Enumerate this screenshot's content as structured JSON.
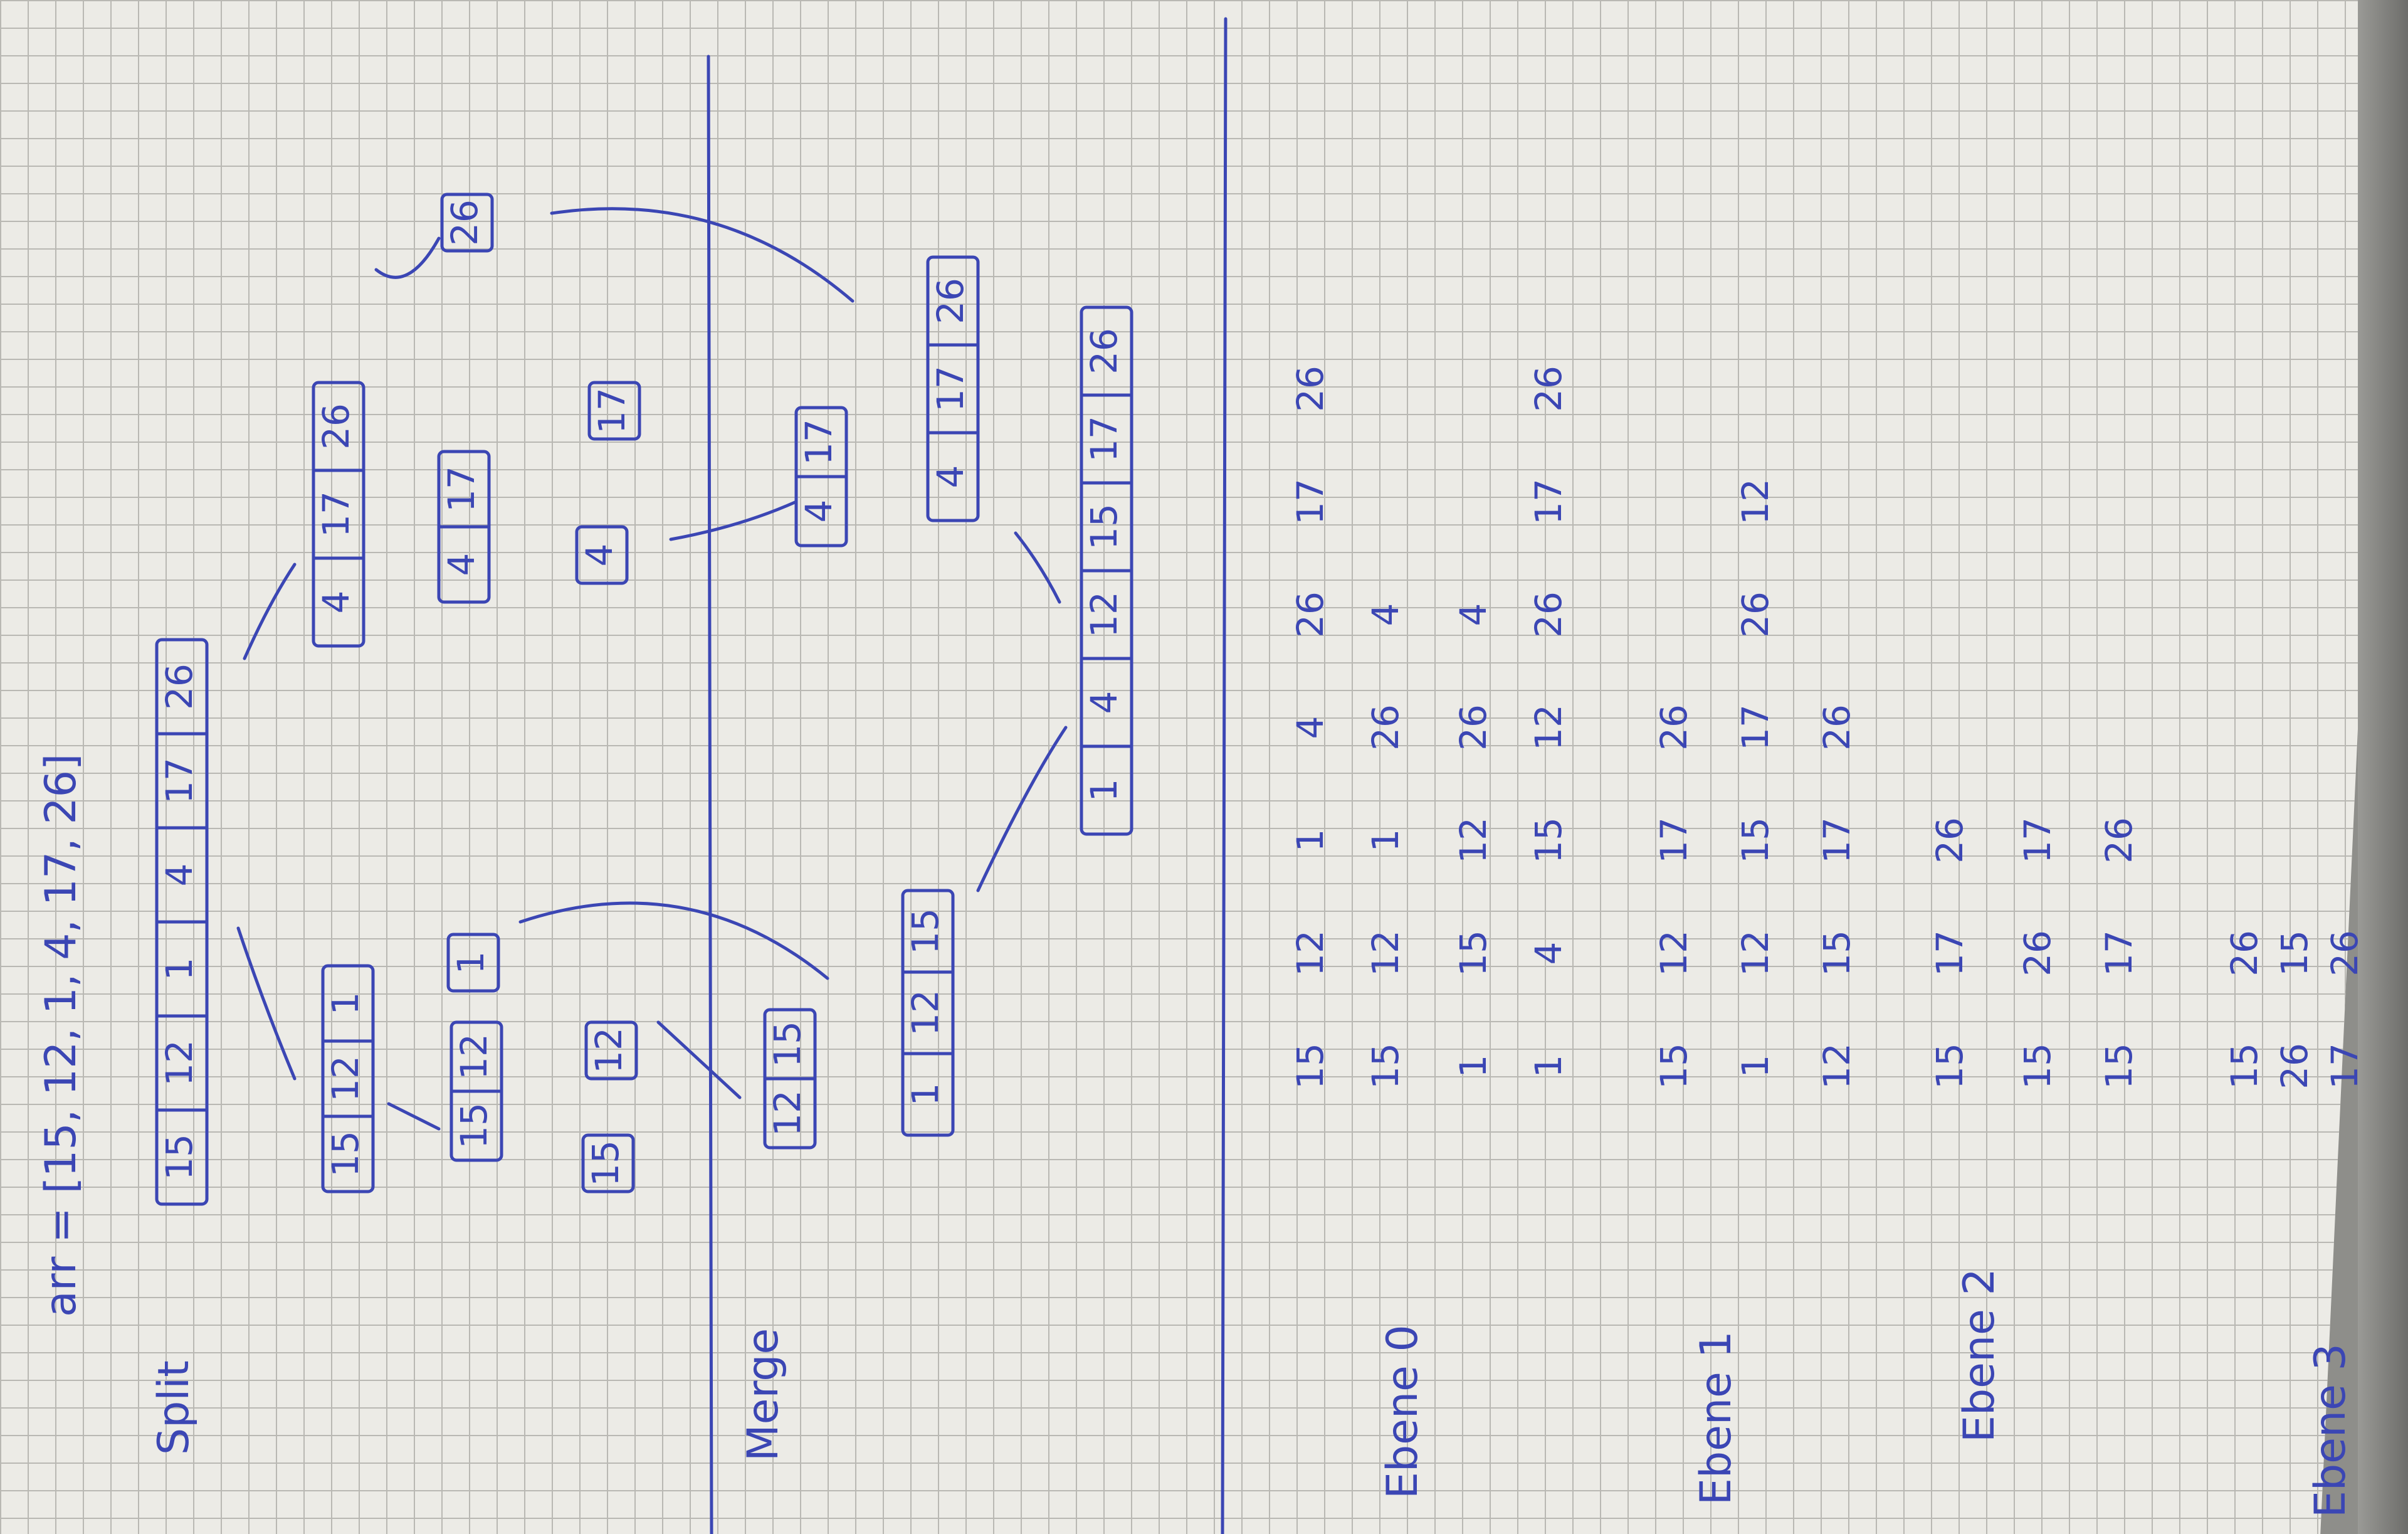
{
  "colors": {
    "ink": "#3b46b4",
    "paper": "#ecebe6",
    "grid": "#b9b8b3"
  },
  "title": "arr = [15, 12, 1, 4, 17, 26]",
  "labels": {
    "split": "Split",
    "merge": "Merge",
    "ebene0": "Ebene 0",
    "ebene1": "Ebene 1",
    "ebene2": "Ebene 2",
    "ebene3": "Ebene 3"
  },
  "split_tree": {
    "root": [
      "15",
      "12",
      "1",
      "4",
      "17",
      "26"
    ],
    "left": [
      "15",
      "12",
      "1"
    ],
    "right": [
      "4",
      "17",
      "26"
    ],
    "left_left": [
      "15",
      "12"
    ],
    "left_right": [
      "1"
    ],
    "right_left": [
      "4",
      "17"
    ],
    "right_right": [
      "26"
    ],
    "leaves": [
      "15",
      "12",
      "4",
      "17"
    ]
  },
  "merge_tree": {
    "m1": [
      "12",
      "15"
    ],
    "m2": [
      "4",
      "17"
    ],
    "m3": [
      "1",
      "12",
      "15"
    ],
    "m4": [
      "4",
      "17",
      "26"
    ],
    "result": [
      "1",
      "4",
      "12",
      "15",
      "17",
      "26"
    ]
  },
  "trace": {
    "ebene0": [
      [
        "15",
        "12",
        "1",
        "4",
        "26",
        "17",
        "26"
      ],
      [
        "15",
        "12",
        "1",
        "26",
        "4"
      ],
      [
        "1",
        "15",
        "12",
        "26",
        "4"
      ],
      [
        "1",
        "4",
        "15",
        "12",
        "26",
        "17",
        "26"
      ]
    ],
    "ebene1": [
      [
        "15",
        "12",
        "17",
        "26"
      ],
      [
        "1",
        "12",
        "15",
        "17",
        "26",
        "12"
      ],
      [
        "12",
        "15",
        "17",
        "26"
      ]
    ],
    "ebene2": [
      [
        "15",
        "17",
        "26"
      ],
      [
        "15",
        "26",
        "17"
      ],
      [
        "15",
        "17",
        "26"
      ]
    ],
    "ebene3": [
      [
        "15",
        "26"
      ],
      [
        "26",
        "15"
      ],
      [
        "17",
        "26"
      ]
    ]
  }
}
